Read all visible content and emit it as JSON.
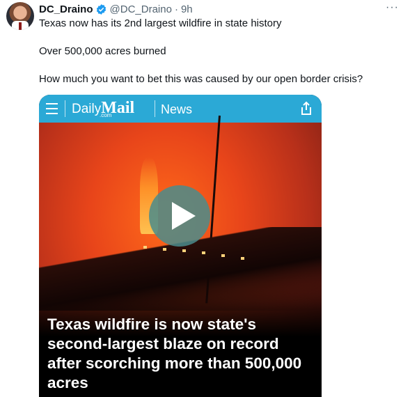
{
  "tweet": {
    "author_name": "DC_Draino",
    "handle": "@DC_Draino",
    "separator": "·",
    "time": "9h",
    "more": "···",
    "lines": [
      "Texas now has its 2nd largest wildfire in state history",
      "Over 500,000 acres burned",
      "How much you want to bet this was caused by our open border crisis?"
    ]
  },
  "media": {
    "brand_daily": "Daily",
    "brand_mail": "Mail",
    "brand_com": ".com",
    "section": "News",
    "headline": "Texas wildfire is now state's second-largest blaze on record after scorching more than 500,000 acres",
    "bar_color": "#2ba9d6",
    "play_icon": "play-icon"
  },
  "colors": {
    "verified": "#1d9bf0",
    "muted": "#536471",
    "text": "#0f1419"
  }
}
